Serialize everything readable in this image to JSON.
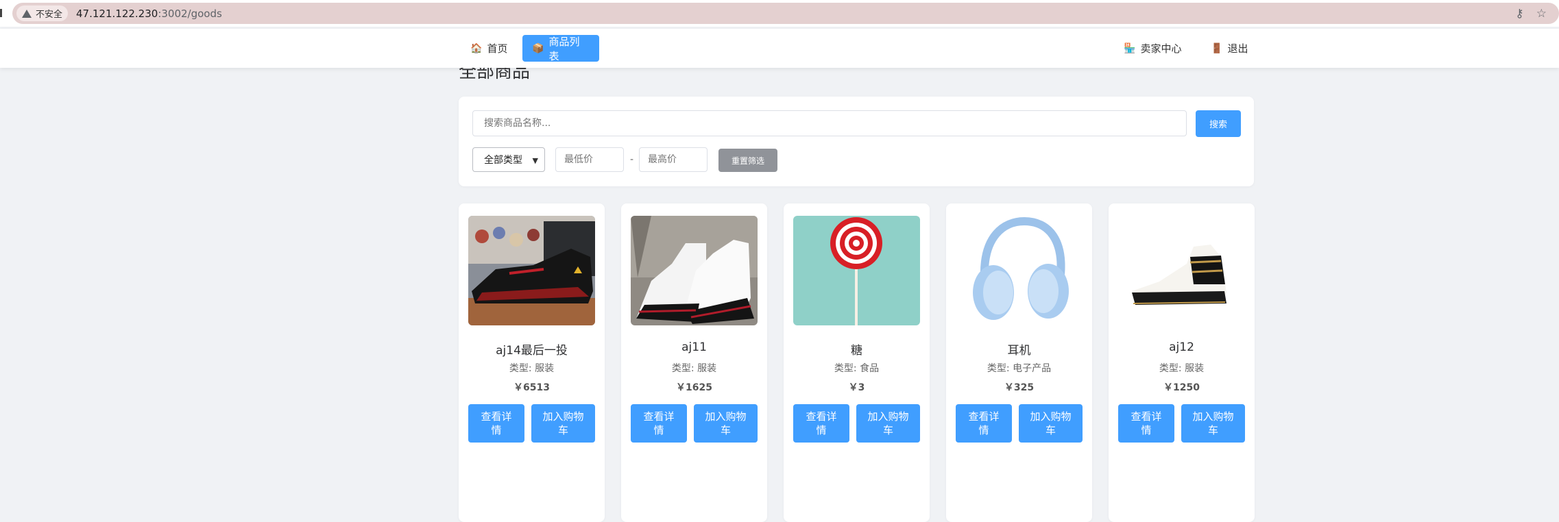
{
  "browser": {
    "security_label": "不安全",
    "url_host": "47.121.122.230",
    "url_path": ":3002/goods"
  },
  "nav": {
    "home": {
      "icon": "🏠",
      "label": "首页"
    },
    "goods": {
      "icon": "📦",
      "label": "商品列表"
    },
    "seller": {
      "icon": "🏪",
      "label": "卖家中心"
    },
    "logout": {
      "icon": "🚪",
      "label": "退出"
    }
  },
  "page": {
    "heading": "全部商品"
  },
  "filters": {
    "search_placeholder": "搜索商品名称...",
    "search_button": "搜索",
    "type_selected": "全部类型",
    "min_price_placeholder": "最低价",
    "price_separator": "-",
    "max_price_placeholder": "最高价",
    "reset_button": "重置筛选"
  },
  "goods": [
    {
      "name": "aj14最后一投",
      "type": "类型: 服装",
      "price": "￥6513",
      "detail_button": "查看详情",
      "cart_button": "加入购物车"
    },
    {
      "name": "aj11",
      "type": "类型: 服装",
      "price": "￥1625",
      "detail_button": "查看详情",
      "cart_button": "加入购物车"
    },
    {
      "name": "糖",
      "type": "类型: 食品",
      "price": "￥3",
      "detail_button": "查看详情",
      "cart_button": "加入购物车"
    },
    {
      "name": "耳机",
      "type": "类型: 电子产品",
      "price": "￥325",
      "detail_button": "查看详情",
      "cart_button": "加入购物车"
    },
    {
      "name": "aj12",
      "type": "类型: 服装",
      "price": "￥1250",
      "detail_button": "查看详情",
      "cart_button": "加入购物车"
    }
  ],
  "colors": {
    "primary": "#409eff",
    "reset": "#909399",
    "page_bg": "#f0f2f5"
  }
}
